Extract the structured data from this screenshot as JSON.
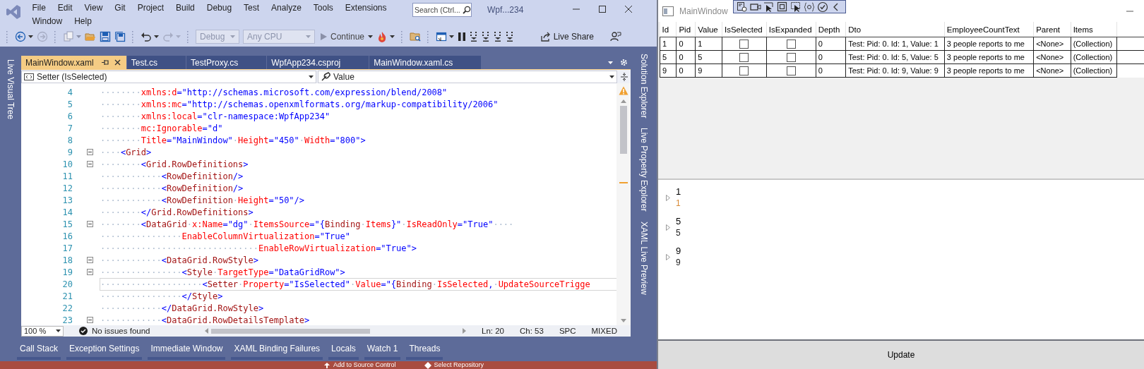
{
  "vs": {
    "menu_rows": [
      [
        "File",
        "Edit",
        "View",
        "Git",
        "Project",
        "Build",
        "Debug",
        "Test",
        "Analyze",
        "Tools",
        "Extensions"
      ],
      [
        "Window",
        "Help"
      ]
    ],
    "search": {
      "placeholder": "Search (Ctrl..."
    },
    "title": "Wpf...234",
    "toolbar": {
      "configuration": {
        "value": "Debug",
        "disabled": true
      },
      "platform": {
        "value": "Any CPU",
        "disabled": true
      },
      "continue": "Continue",
      "live_share": "Live Share"
    },
    "left_tool_tabs": [
      "Live Visual Tree"
    ],
    "doc_tabs": [
      {
        "label": "MainWindow.xaml",
        "selected": true,
        "pinned": true
      },
      {
        "label": "Test.cs",
        "selected": false,
        "pinned": false
      },
      {
        "label": "TestProxy.cs",
        "selected": false,
        "pinned": false
      },
      {
        "label": "WpfApp234.csproj",
        "selected": false,
        "pinned": false
      },
      {
        "label": "MainWindow.xaml.cs",
        "selected": false,
        "pinned": false
      }
    ],
    "nav": {
      "type_dropdown": "Setter (IsSelected)",
      "member_dropdown": "Value"
    },
    "code_lines": [
      {
        "number": "4",
        "fold": false,
        "current": false,
        "segments": [
          {
            "kind": "w",
            "text": "········"
          },
          {
            "kind": "a",
            "text": "xmlns:d"
          },
          {
            "kind": "v",
            "text": "=\"http://schemas.microsoft.com/expression/blend/2008\""
          }
        ]
      },
      {
        "number": "5",
        "fold": false,
        "current": false,
        "segments": [
          {
            "kind": "w",
            "text": "········"
          },
          {
            "kind": "a",
            "text": "xmlns:mc"
          },
          {
            "kind": "v",
            "text": "=\"http://schemas.openxmlformats.org/markup-compatibility/2006\""
          }
        ]
      },
      {
        "number": "6",
        "fold": false,
        "current": false,
        "segments": [
          {
            "kind": "w",
            "text": "········"
          },
          {
            "kind": "a",
            "text": "xmlns:local"
          },
          {
            "kind": "v",
            "text": "=\"clr-namespace:WpfApp234\""
          }
        ]
      },
      {
        "number": "7",
        "fold": false,
        "current": false,
        "segments": [
          {
            "kind": "w",
            "text": "········"
          },
          {
            "kind": "a",
            "text": "mc:Ignorable"
          },
          {
            "kind": "v",
            "text": "=\"d\""
          }
        ]
      },
      {
        "number": "8",
        "fold": false,
        "current": false,
        "segments": [
          {
            "kind": "w",
            "text": "········"
          },
          {
            "kind": "a",
            "text": "Title"
          },
          {
            "kind": "v",
            "text": "=\"MainWindow\""
          },
          {
            "kind": "w",
            "text": "·"
          },
          {
            "kind": "a",
            "text": "Height"
          },
          {
            "kind": "v",
            "text": "=\"450\""
          },
          {
            "kind": "w",
            "text": "·"
          },
          {
            "kind": "a",
            "text": "Width"
          },
          {
            "kind": "v",
            "text": "=\"800\">"
          }
        ]
      },
      {
        "number": "9",
        "fold": true,
        "current": false,
        "segments": [
          {
            "kind": "w",
            "text": "····"
          },
          {
            "kind": "v",
            "text": "<"
          },
          {
            "kind": "t",
            "text": "Grid"
          },
          {
            "kind": "v",
            "text": ">"
          }
        ]
      },
      {
        "number": "10",
        "fold": true,
        "current": false,
        "segments": [
          {
            "kind": "w",
            "text": "········"
          },
          {
            "kind": "v",
            "text": "<"
          },
          {
            "kind": "t",
            "text": "Grid.RowDefinitions"
          },
          {
            "kind": "v",
            "text": ">"
          }
        ]
      },
      {
        "number": "11",
        "fold": false,
        "current": false,
        "segments": [
          {
            "kind": "w",
            "text": "············"
          },
          {
            "kind": "v",
            "text": "<"
          },
          {
            "kind": "t",
            "text": "RowDefinition"
          },
          {
            "kind": "v",
            "text": "/>"
          }
        ]
      },
      {
        "number": "12",
        "fold": false,
        "current": false,
        "segments": [
          {
            "kind": "w",
            "text": "············"
          },
          {
            "kind": "v",
            "text": "<"
          },
          {
            "kind": "t",
            "text": "RowDefinition"
          },
          {
            "kind": "v",
            "text": "/>"
          }
        ]
      },
      {
        "number": "13",
        "fold": false,
        "current": false,
        "segments": [
          {
            "kind": "w",
            "text": "············"
          },
          {
            "kind": "v",
            "text": "<"
          },
          {
            "kind": "t",
            "text": "RowDefinition"
          },
          {
            "kind": "w",
            "text": "·"
          },
          {
            "kind": "a",
            "text": "Height"
          },
          {
            "kind": "v",
            "text": "=\"50\"/>"
          }
        ]
      },
      {
        "number": "14",
        "fold": false,
        "current": false,
        "segments": [
          {
            "kind": "w",
            "text": "········"
          },
          {
            "kind": "v",
            "text": "</"
          },
          {
            "kind": "t",
            "text": "Grid.RowDefinitions"
          },
          {
            "kind": "v",
            "text": ">"
          }
        ]
      },
      {
        "number": "15",
        "fold": true,
        "current": false,
        "segments": [
          {
            "kind": "w",
            "text": "········"
          },
          {
            "kind": "v",
            "text": "<"
          },
          {
            "kind": "t",
            "text": "DataGrid"
          },
          {
            "kind": "w",
            "text": "·"
          },
          {
            "kind": "a",
            "text": "x:Name"
          },
          {
            "kind": "v",
            "text": "=\"dg\""
          },
          {
            "kind": "w",
            "text": "·"
          },
          {
            "kind": "a",
            "text": "ItemsSource"
          },
          {
            "kind": "v",
            "text": "=\"{"
          },
          {
            "kind": "t",
            "text": "Binding"
          },
          {
            "kind": "w",
            "text": "·"
          },
          {
            "kind": "a",
            "text": "Items"
          },
          {
            "kind": "v",
            "text": "}\""
          },
          {
            "kind": "w",
            "text": "·"
          },
          {
            "kind": "a",
            "text": "IsReadOnly"
          },
          {
            "kind": "v",
            "text": "=\"True\""
          },
          {
            "kind": "w",
            "text": "····"
          }
        ]
      },
      {
        "number": "16",
        "fold": false,
        "current": false,
        "segments": [
          {
            "kind": "w",
            "text": "················"
          },
          {
            "kind": "a",
            "text": "EnableColumnVirtualization"
          },
          {
            "kind": "v",
            "text": "=\"True\""
          }
        ]
      },
      {
        "number": "17",
        "fold": false,
        "current": false,
        "segments": [
          {
            "kind": "w",
            "text": "·······························"
          },
          {
            "kind": "a",
            "text": "EnableRowVirtualization"
          },
          {
            "kind": "v",
            "text": "=\"True\">"
          }
        ]
      },
      {
        "number": "18",
        "fold": true,
        "current": false,
        "segments": [
          {
            "kind": "w",
            "text": "············"
          },
          {
            "kind": "v",
            "text": "<"
          },
          {
            "kind": "t",
            "text": "DataGrid.RowStyle"
          },
          {
            "kind": "v",
            "text": ">"
          }
        ]
      },
      {
        "number": "19",
        "fold": true,
        "current": false,
        "segments": [
          {
            "kind": "w",
            "text": "················"
          },
          {
            "kind": "v",
            "text": "<"
          },
          {
            "kind": "t",
            "text": "Style"
          },
          {
            "kind": "w",
            "text": "·"
          },
          {
            "kind": "a",
            "text": "TargetType"
          },
          {
            "kind": "v",
            "text": "=\"DataGridRow\">"
          }
        ]
      },
      {
        "number": "20",
        "fold": false,
        "current": true,
        "segments": [
          {
            "kind": "w",
            "text": "····················"
          },
          {
            "kind": "v",
            "text": "<"
          },
          {
            "kind": "t",
            "text": "Setter"
          },
          {
            "kind": "w",
            "text": "·"
          },
          {
            "kind": "a",
            "text": "Property"
          },
          {
            "kind": "v",
            "text": "=\"IsSelected\""
          },
          {
            "kind": "w",
            "text": "·"
          },
          {
            "kind": "a",
            "text": "Value"
          },
          {
            "kind": "v",
            "text": "=\"{"
          },
          {
            "kind": "t",
            "text": "Binding"
          },
          {
            "kind": "w",
            "text": "·"
          },
          {
            "kind": "a",
            "text": "IsSelected"
          },
          {
            "kind": "v",
            "text": ","
          },
          {
            "kind": "w",
            "text": "·"
          },
          {
            "kind": "a",
            "text": "UpdateSourceTrigge"
          }
        ]
      },
      {
        "number": "21",
        "fold": false,
        "current": false,
        "segments": [
          {
            "kind": "w",
            "text": "················"
          },
          {
            "kind": "v",
            "text": "</"
          },
          {
            "kind": "t",
            "text": "Style"
          },
          {
            "kind": "v",
            "text": ">"
          }
        ]
      },
      {
        "number": "22",
        "fold": false,
        "current": false,
        "segments": [
          {
            "kind": "w",
            "text": "············"
          },
          {
            "kind": "v",
            "text": "</"
          },
          {
            "kind": "t",
            "text": "DataGrid.RowStyle"
          },
          {
            "kind": "v",
            "text": ">"
          }
        ]
      },
      {
        "number": "23",
        "fold": true,
        "current": false,
        "segments": [
          {
            "kind": "w",
            "text": "············"
          },
          {
            "kind": "v",
            "text": "<"
          },
          {
            "kind": "t",
            "text": "DataGrid.RowDetailsTemplate"
          },
          {
            "kind": "v",
            "text": ">"
          }
        ]
      }
    ],
    "editor_status": {
      "zoom": "100 %",
      "issues": "No issues found",
      "line": "Ln: 20",
      "column": "Ch: 53",
      "whitespace": "SPC",
      "line_endings": "MIXED"
    },
    "right_tool_tabs": [
      "Solution Explorer",
      "Live Property Explorer",
      "XAML Live Preview"
    ],
    "bottom_tabs": [
      "Call Stack",
      "Exception Settings",
      "Immediate Window",
      "XAML Binding Failures",
      "Locals",
      "Watch 1",
      "Threads"
    ],
    "status_bar": {
      "source_control": "Add to Source Control",
      "repository": "Select Repository"
    }
  },
  "app": {
    "title": "MainWindow",
    "table": {
      "columns": [
        "Id",
        "Pid",
        "Value",
        "IsSelected",
        "IsExpanded",
        "Depth",
        "Dto",
        "EmployeeCountText",
        "Parent",
        "Items"
      ],
      "rows": [
        {
          "cells": [
            {
              "kind": "text",
              "text": "1"
            },
            {
              "kind": "text",
              "text": "0"
            },
            {
              "kind": "text",
              "text": "1"
            },
            {
              "kind": "checkbox",
              "checked": false
            },
            {
              "kind": "checkbox",
              "checked": false
            },
            {
              "kind": "text",
              "text": "0"
            },
            {
              "kind": "text",
              "text": "Test: Pid: 0. Id: 1, Value: 1"
            },
            {
              "kind": "text",
              "text": "3 people reports to me"
            },
            {
              "kind": "text",
              "text": "<None>"
            },
            {
              "kind": "text",
              "text": "(Collection)"
            }
          ]
        },
        {
          "cells": [
            {
              "kind": "text",
              "text": "5"
            },
            {
              "kind": "text",
              "text": "0"
            },
            {
              "kind": "text",
              "text": "5"
            },
            {
              "kind": "checkbox",
              "checked": false
            },
            {
              "kind": "checkbox",
              "checked": false
            },
            {
              "kind": "text",
              "text": "0"
            },
            {
              "kind": "text",
              "text": "Test: Pid: 0. Id: 5, Value: 5"
            },
            {
              "kind": "text",
              "text": "3 people reports to me"
            },
            {
              "kind": "text",
              "text": "<None>"
            },
            {
              "kind": "text",
              "text": "(Collection)"
            }
          ]
        },
        {
          "cells": [
            {
              "kind": "text",
              "text": "9"
            },
            {
              "kind": "text",
              "text": "0"
            },
            {
              "kind": "text",
              "text": "9"
            },
            {
              "kind": "checkbox",
              "checked": false
            },
            {
              "kind": "checkbox",
              "checked": false
            },
            {
              "kind": "text",
              "text": "0"
            },
            {
              "kind": "text",
              "text": "Test: Pid: 0. Id: 9, Value: 9"
            },
            {
              "kind": "text",
              "text": "3 people reports to me"
            },
            {
              "kind": "text",
              "text": "<None>"
            },
            {
              "kind": "text",
              "text": "(Collection)"
            }
          ]
        }
      ]
    },
    "list": [
      {
        "title": "1",
        "detail": "1",
        "color": "#d98a36"
      },
      {
        "title": "5",
        "detail": "5",
        "color": "#222222"
      },
      {
        "title": "9",
        "detail": "9",
        "color": "#222222"
      }
    ],
    "button": "Update"
  }
}
